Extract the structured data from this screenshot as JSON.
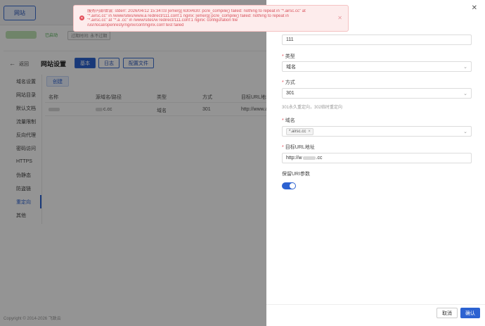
{
  "topbar": {
    "site_button": "网站"
  },
  "status": {
    "state": "已启动",
    "expiry": "过期时间: 永不过期"
  },
  "panel": {
    "back": "返回",
    "title": "网站设置",
    "tabs": [
      "基本",
      "日志",
      "配置文件"
    ],
    "sidebar": [
      "域名设置",
      "网站目录",
      "默认文档",
      "流量限制",
      "反向代理",
      "密码访问",
      "HTTPS",
      "伪静态",
      "防盗链",
      "重定向",
      "其他"
    ],
    "active_sidebar": "重定向",
    "create_button": "创建",
    "columns": [
      "名称",
      "源域名/路径",
      "类型",
      "方式",
      "目标URL地址"
    ],
    "row": {
      "source_suffix": "c.cc",
      "type": "域名",
      "method": "301",
      "target_prefix": "http://www.a"
    }
  },
  "footer": "Copyright © 2014-2026 飞致云",
  "drawer": {
    "name_value": "111",
    "type_label": "类型",
    "type_value": "域名",
    "method_label": "方式",
    "method_value": "301",
    "method_hint": "301永久重定向，302临时重定向",
    "domain_label": "域名",
    "domain_tag": "*.airsc.cc",
    "target_label": "目标URL地址",
    "target_prefix": "http://w",
    "target_suffix": ".cc",
    "keep_uri_label": "保留URI参数",
    "cancel": "取消",
    "confirm": "确认"
  },
  "toast": {
    "lines": [
      "服务内部错误: stderr: 2026/04/12 15:34:03 [emerg] 630#630: pcre_compile() failed: nothing to repeat in \"*.airsc.cc\" at",
      "\"*.airsc.cc\" in /www/sites/www.a            redirect/111.conf:1 nginx: [emerg] pcre_compile() failed: nothing to repeat in",
      "\"*.airsc.cc\" at \"*.a         .cc\" in /www/sites/w           redirect/111.conf:1 nginx: configuration file",
      "/usr/local/openresty/nginx/conf/nginx.conf test failed"
    ]
  }
}
